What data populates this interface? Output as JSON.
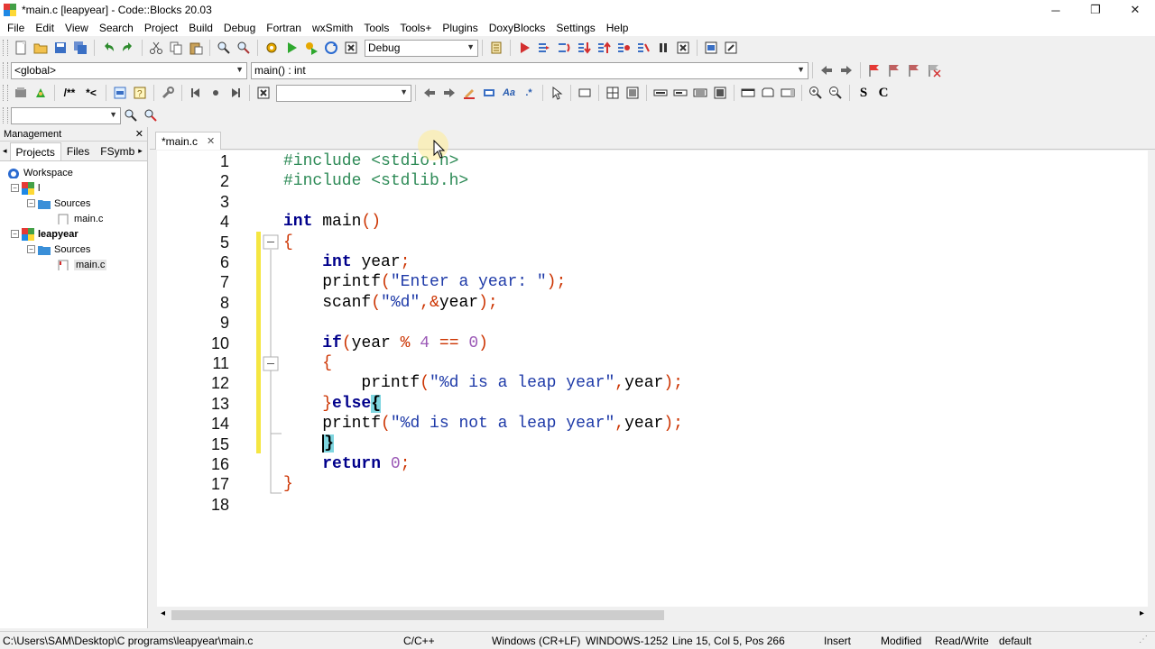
{
  "window": {
    "title": "*main.c [leapyear] - Code::Blocks 20.03",
    "minimize": "─",
    "restore": "❐",
    "close": "✕"
  },
  "menu": [
    "File",
    "Edit",
    "View",
    "Search",
    "Project",
    "Build",
    "Debug",
    "Fortran",
    "wxSmith",
    "Tools",
    "Tools+",
    "Plugins",
    "DoxyBlocks",
    "Settings",
    "Help"
  ],
  "toolbar": {
    "build_target": "Debug",
    "scope": "<global>",
    "function": "main() : int",
    "search_text": "",
    "jump_text": ""
  },
  "management": {
    "title": "Management",
    "close": "✕",
    "tabs": [
      "Projects",
      "Files",
      "FSymb"
    ],
    "tree": {
      "workspace": "Workspace",
      "project1": "l",
      "sources1": "Sources",
      "file1": "main.c",
      "project2": "leapyear",
      "sources2": "Sources",
      "file2": "main.c"
    }
  },
  "editor": {
    "tab": "*main.c",
    "tab_close": "✕",
    "line_numbers": [
      "1",
      "2",
      "3",
      "4",
      "5",
      "6",
      "7",
      "8",
      "9",
      "10",
      "11",
      "12",
      "13",
      "14",
      "15",
      "16",
      "17",
      "18"
    ],
    "lines": [
      "#include <stdio.h>",
      "#include <stdlib.h>",
      "",
      "int main()",
      "{",
      "    int year;",
      "    printf(\"Enter a year: \");",
      "    scanf(\"%d\",&year);",
      "",
      "    if(year % 4 == 0)",
      "    {",
      "        printf(\"%d is a leap year\",year);",
      "    }else{",
      "    printf(\"%d is not a leap year\",year);",
      "    }",
      "    return 0;",
      "}",
      ""
    ]
  },
  "status": {
    "path": "C:\\Users\\SAM\\Desktop\\C programs\\leapyear\\main.c",
    "language": "C/C++",
    "eol": "Windows (CR+LF)",
    "encoding": "WINDOWS-1252",
    "position": "Line 15, Col 5, Pos 266",
    "mode": "Insert",
    "modified": "Modified",
    "access": "Read/Write",
    "profile": "default"
  }
}
